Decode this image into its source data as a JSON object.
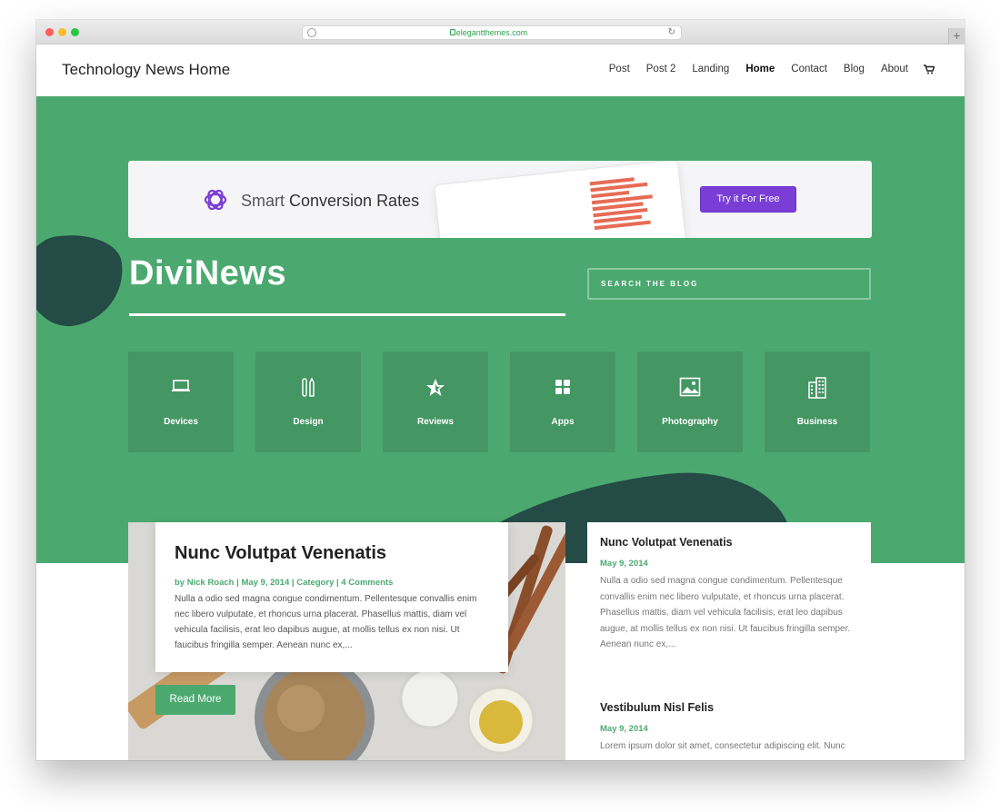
{
  "browser": {
    "url": "elegantthemes.com",
    "new_tab": "+"
  },
  "header": {
    "site_title": "Technology News Home",
    "nav": [
      "Post",
      "Post 2",
      "Landing",
      "Home",
      "Contact",
      "Blog",
      "About"
    ],
    "active_nav": "Home"
  },
  "ad": {
    "text_light": "Smart ",
    "text_strong": "Conversion Rates",
    "button": "Try it For Free",
    "brand_color": "#7a3ed6"
  },
  "hero": {
    "brand": "DiviNews",
    "search_placeholder": "SEARCH THE BLOG",
    "accent_color": "#4ba96f",
    "dark_color": "#244b45"
  },
  "categories": [
    {
      "label": "Devices",
      "icon": "laptop-icon"
    },
    {
      "label": "Design",
      "icon": "pen-tools-icon"
    },
    {
      "label": "Reviews",
      "icon": "star-icon"
    },
    {
      "label": "Apps",
      "icon": "grid-icon"
    },
    {
      "label": "Photography",
      "icon": "image-icon"
    },
    {
      "label": "Business",
      "icon": "building-icon"
    }
  ],
  "featured_post": {
    "title": "Nunc Volutpat Venenatis",
    "meta_by": "by ",
    "author": "Nick Roach",
    "date": "May 9, 2014",
    "category": "Category",
    "comments": "4 Comments",
    "excerpt": "Nulla a odio sed magna congue condimentum. Pellentesque convallis enim nec libero vulputate, et rhoncus urna placerat. Phasellus mattis, diam vel vehicula facilisis, erat leo dapibus augue, at mollis tellus ex non nisi. Ut faucibus fringilla semper. Aenean nunc ex,...",
    "read_more": "Read More"
  },
  "side_posts": [
    {
      "title": "Nunc Volutpat Venenatis",
      "date": "May 9, 2014",
      "excerpt": "Nulla a odio sed magna congue condimentum. Pellentesque convallis enim nec libero vulputate, et rhoncus urna placerat. Phasellus mattis, diam vel vehicula facilisis, erat leo dapibus augue, at mollis tellus ex non nisi. Ut faucibus fringilla semper. Aenean nunc ex,..."
    },
    {
      "title": "Vestibulum Nisl Felis",
      "date": "May 9, 2014",
      "excerpt": "Lorem ipsum dolor sit amet, consectetur adipiscing elit. Nunc"
    }
  ]
}
